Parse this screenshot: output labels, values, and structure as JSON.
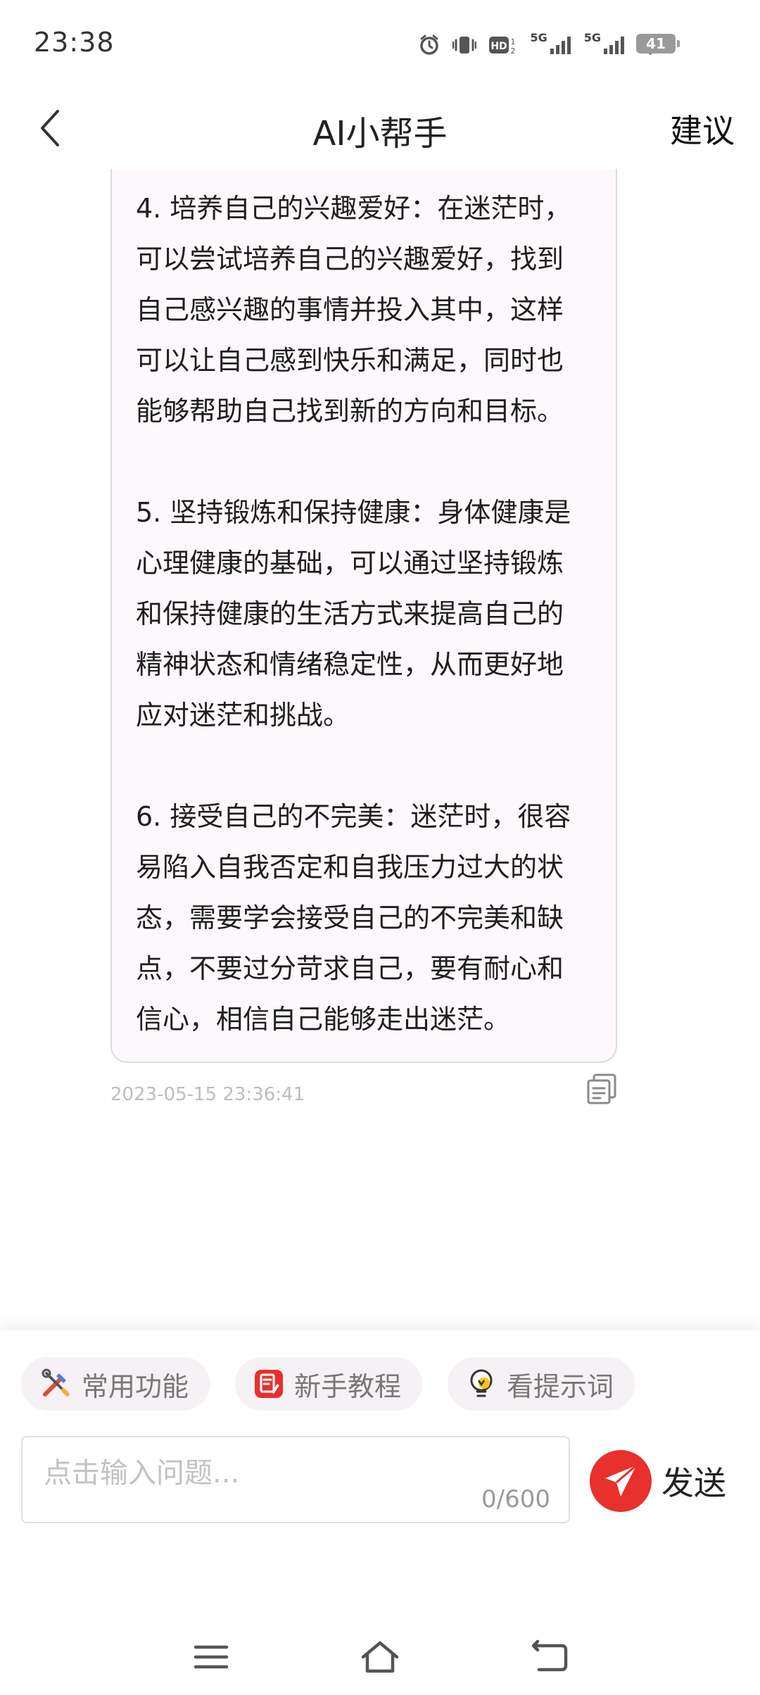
{
  "status_bar": {
    "time": "23:38",
    "network_1": "5G",
    "network_2": "5G",
    "battery": "41"
  },
  "header": {
    "title": "AI小帮手",
    "suggest_label": "建议"
  },
  "message": {
    "paragraphs": [
      "4. 培养自己的兴趣爱好：在迷茫时，可以尝试培养自己的兴趣爱好，找到自己感兴趣的事情并投入其中，这样可以让自己感到快乐和满足，同时也能够帮助自己找到新的方向和目标。",
      "5. 坚持锻炼和保持健康：身体健康是心理健康的基础，可以通过坚持锻炼和保持健康的生活方式来提高自己的精神状态和情绪稳定性，从而更好地应对迷茫和挑战。",
      "6. 接受自己的不完美：迷茫时，很容易陷入自我否定和自我压力过大的状态，需要学会接受自己的不完美和缺点，不要过分苛求自己，要有耐心和信心，相信自己能够走出迷茫。"
    ],
    "timestamp": "2023-05-15 23:36:41"
  },
  "quick_actions": [
    {
      "label": "常用功能",
      "icon": "tools-icon"
    },
    {
      "label": "新手教程",
      "icon": "tutorial-icon"
    },
    {
      "label": "看提示词",
      "icon": "lightbulb-icon"
    }
  ],
  "input": {
    "placeholder": "点击输入问题...",
    "value": "",
    "char_count": "0/600"
  },
  "send": {
    "label": "发送"
  },
  "colors": {
    "accent_red": "#e8302d",
    "bubble_bg": "#fdf8fc",
    "chip_bg": "#f6f1f4"
  }
}
